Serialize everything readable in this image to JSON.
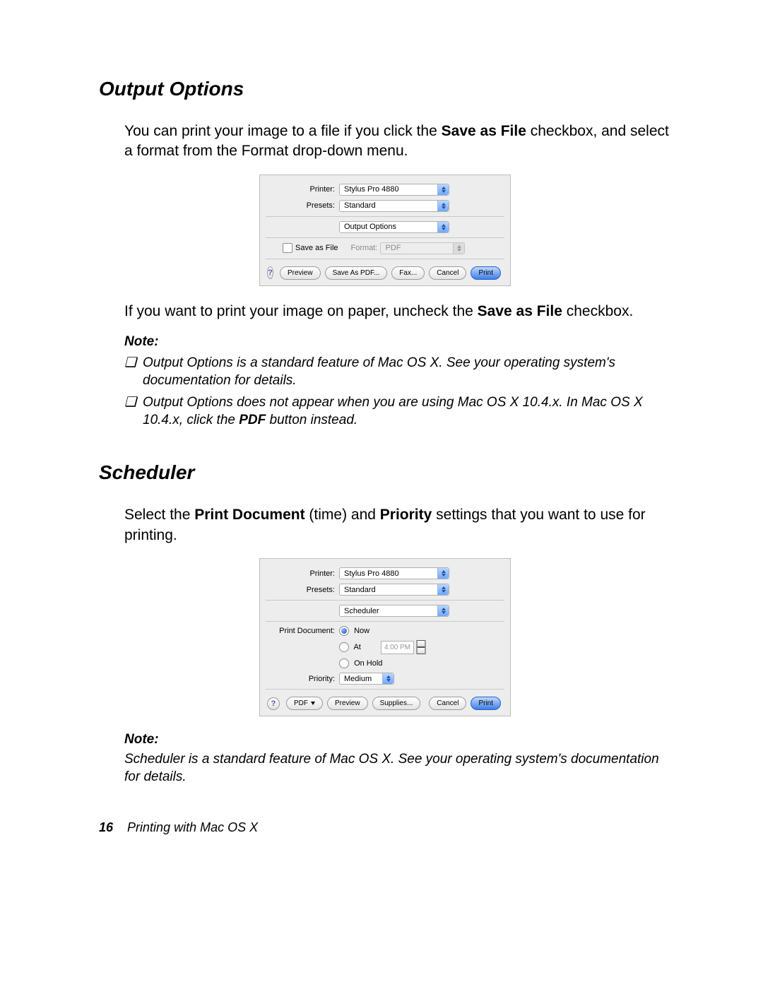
{
  "section1": {
    "heading": "Output Options",
    "p1_a": "You can print your image to a file if you click the ",
    "p1_bold": "Save as File",
    "p1_b": " checkbox, and select a format from the Format drop-down menu.",
    "p2_a": "If you want to print your image on paper, uncheck the ",
    "p2_bold": "Save as File",
    "p2_b": " checkbox.",
    "note_label": "Note:",
    "note1": "Output Options is a standard feature of Mac OS X. See your operating system's documentation for details.",
    "note2_a": "Output Options does not appear when you are using Mac OS X 10.4.x. In Mac OS X 10.4.x, click the ",
    "note2_bold": "PDF",
    "note2_b": " button instead."
  },
  "dialog1": {
    "printer_label": "Printer:",
    "printer_value": "Stylus Pro 4880",
    "presets_label": "Presets:",
    "presets_value": "Standard",
    "pane_value": "Output Options",
    "save_as_file": "Save as File",
    "format_label": "Format:",
    "format_value": "PDF",
    "help": "?",
    "preview": "Preview",
    "save_as_pdf": "Save As PDF...",
    "fax": "Fax...",
    "cancel": "Cancel",
    "print": "Print"
  },
  "section2": {
    "heading": "Scheduler",
    "p1_a": "Select the ",
    "p1_bold1": "Print Document",
    "p1_b": " (time) and ",
    "p1_bold2": "Priority",
    "p1_c": " settings that you want to use for printing.",
    "note_label": "Note:",
    "note1": "Scheduler is a standard feature of Mac OS X. See your operating system's documentation for details."
  },
  "dialog2": {
    "printer_label": "Printer:",
    "printer_value": "Stylus Pro 4880",
    "presets_label": "Presets:",
    "presets_value": "Standard",
    "pane_value": "Scheduler",
    "print_doc_label": "Print Document:",
    "now": "Now",
    "at": "At",
    "at_time": "4:00 PM",
    "on_hold": "On Hold",
    "priority_label": "Priority:",
    "priority_value": "Medium",
    "help": "?",
    "pdf": "PDF",
    "preview": "Preview",
    "supplies": "Supplies...",
    "cancel": "Cancel",
    "print": "Print"
  },
  "footer": {
    "page": "16",
    "title": "Printing with Mac OS X"
  },
  "bullet": "❏"
}
